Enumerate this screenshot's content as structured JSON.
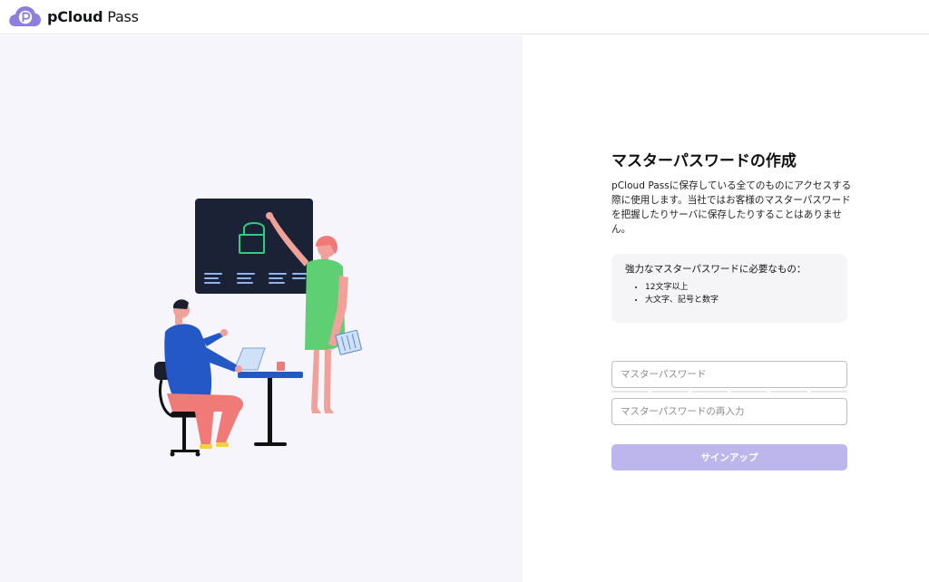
{
  "header": {
    "brand_bold": "pCloud",
    "brand_light": " Pass",
    "logo_icon": "pcloud-p-cloud-logo"
  },
  "form": {
    "heading": "マスターパスワードの作成",
    "description": "pCloud Passに保存している全てのものにアクセスする際に使用します。当社ではお客様のマスターパスワードを把握したりサーバに保存したりすることはありません。",
    "requirements": {
      "title": "強力なマスターパスワードに必要なもの：",
      "items": [
        "12文字以上",
        "大文字、記号と数字"
      ]
    },
    "password": {
      "placeholder": "マスターパスワード",
      "value": ""
    },
    "password_confirm": {
      "placeholder": "マスターパスワードの再入力",
      "value": ""
    },
    "submit_label": "サインアップ"
  },
  "colors": {
    "accent": "#8b7fe0",
    "button_disabled": "#bdb6ec",
    "left_background": "#f6f5fc"
  }
}
